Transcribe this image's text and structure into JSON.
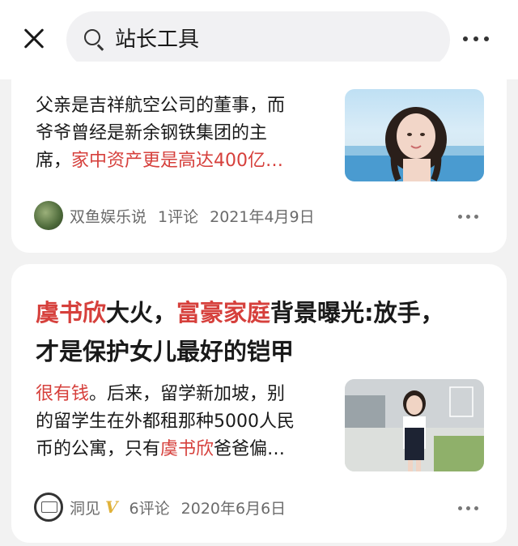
{
  "search": {
    "query": "站长工具",
    "icon": "search-icon"
  },
  "card1": {
    "snippet_line1": "父亲是吉祥航空公司的董事，而",
    "snippet_line2": "爷爷曾经是新余钢铁集团的主",
    "snippet_line3_a": "席，",
    "snippet_line3_b": "家中资产更是高达400亿…",
    "author": "双鱼娱乐说",
    "comments": "1评论",
    "date": "2021年4月9日"
  },
  "card2": {
    "title_l1_a": "虞书欣",
    "title_l1_b": "大火，",
    "title_l1_c": "富豪家庭",
    "title_l1_d": "背景曝光:放手，",
    "title_l2": "才是保护女儿最好的铠甲",
    "snippet_line1_a": "很有钱",
    "snippet_line1_b": "。后来，留学新加坡，别",
    "snippet_line2": "的留学生在外都租那种5000人民",
    "snippet_line3_a": "币的公寓，只有",
    "snippet_line3_b": "虞书欣",
    "snippet_line3_c": "爸爸偏…",
    "author": "洞见",
    "verified_badge": "V",
    "comments": "6评论",
    "date": "2020年6月6日"
  },
  "colors": {
    "highlight": "#d6403c",
    "background": "#f2f2f2",
    "card": "#ffffff"
  }
}
